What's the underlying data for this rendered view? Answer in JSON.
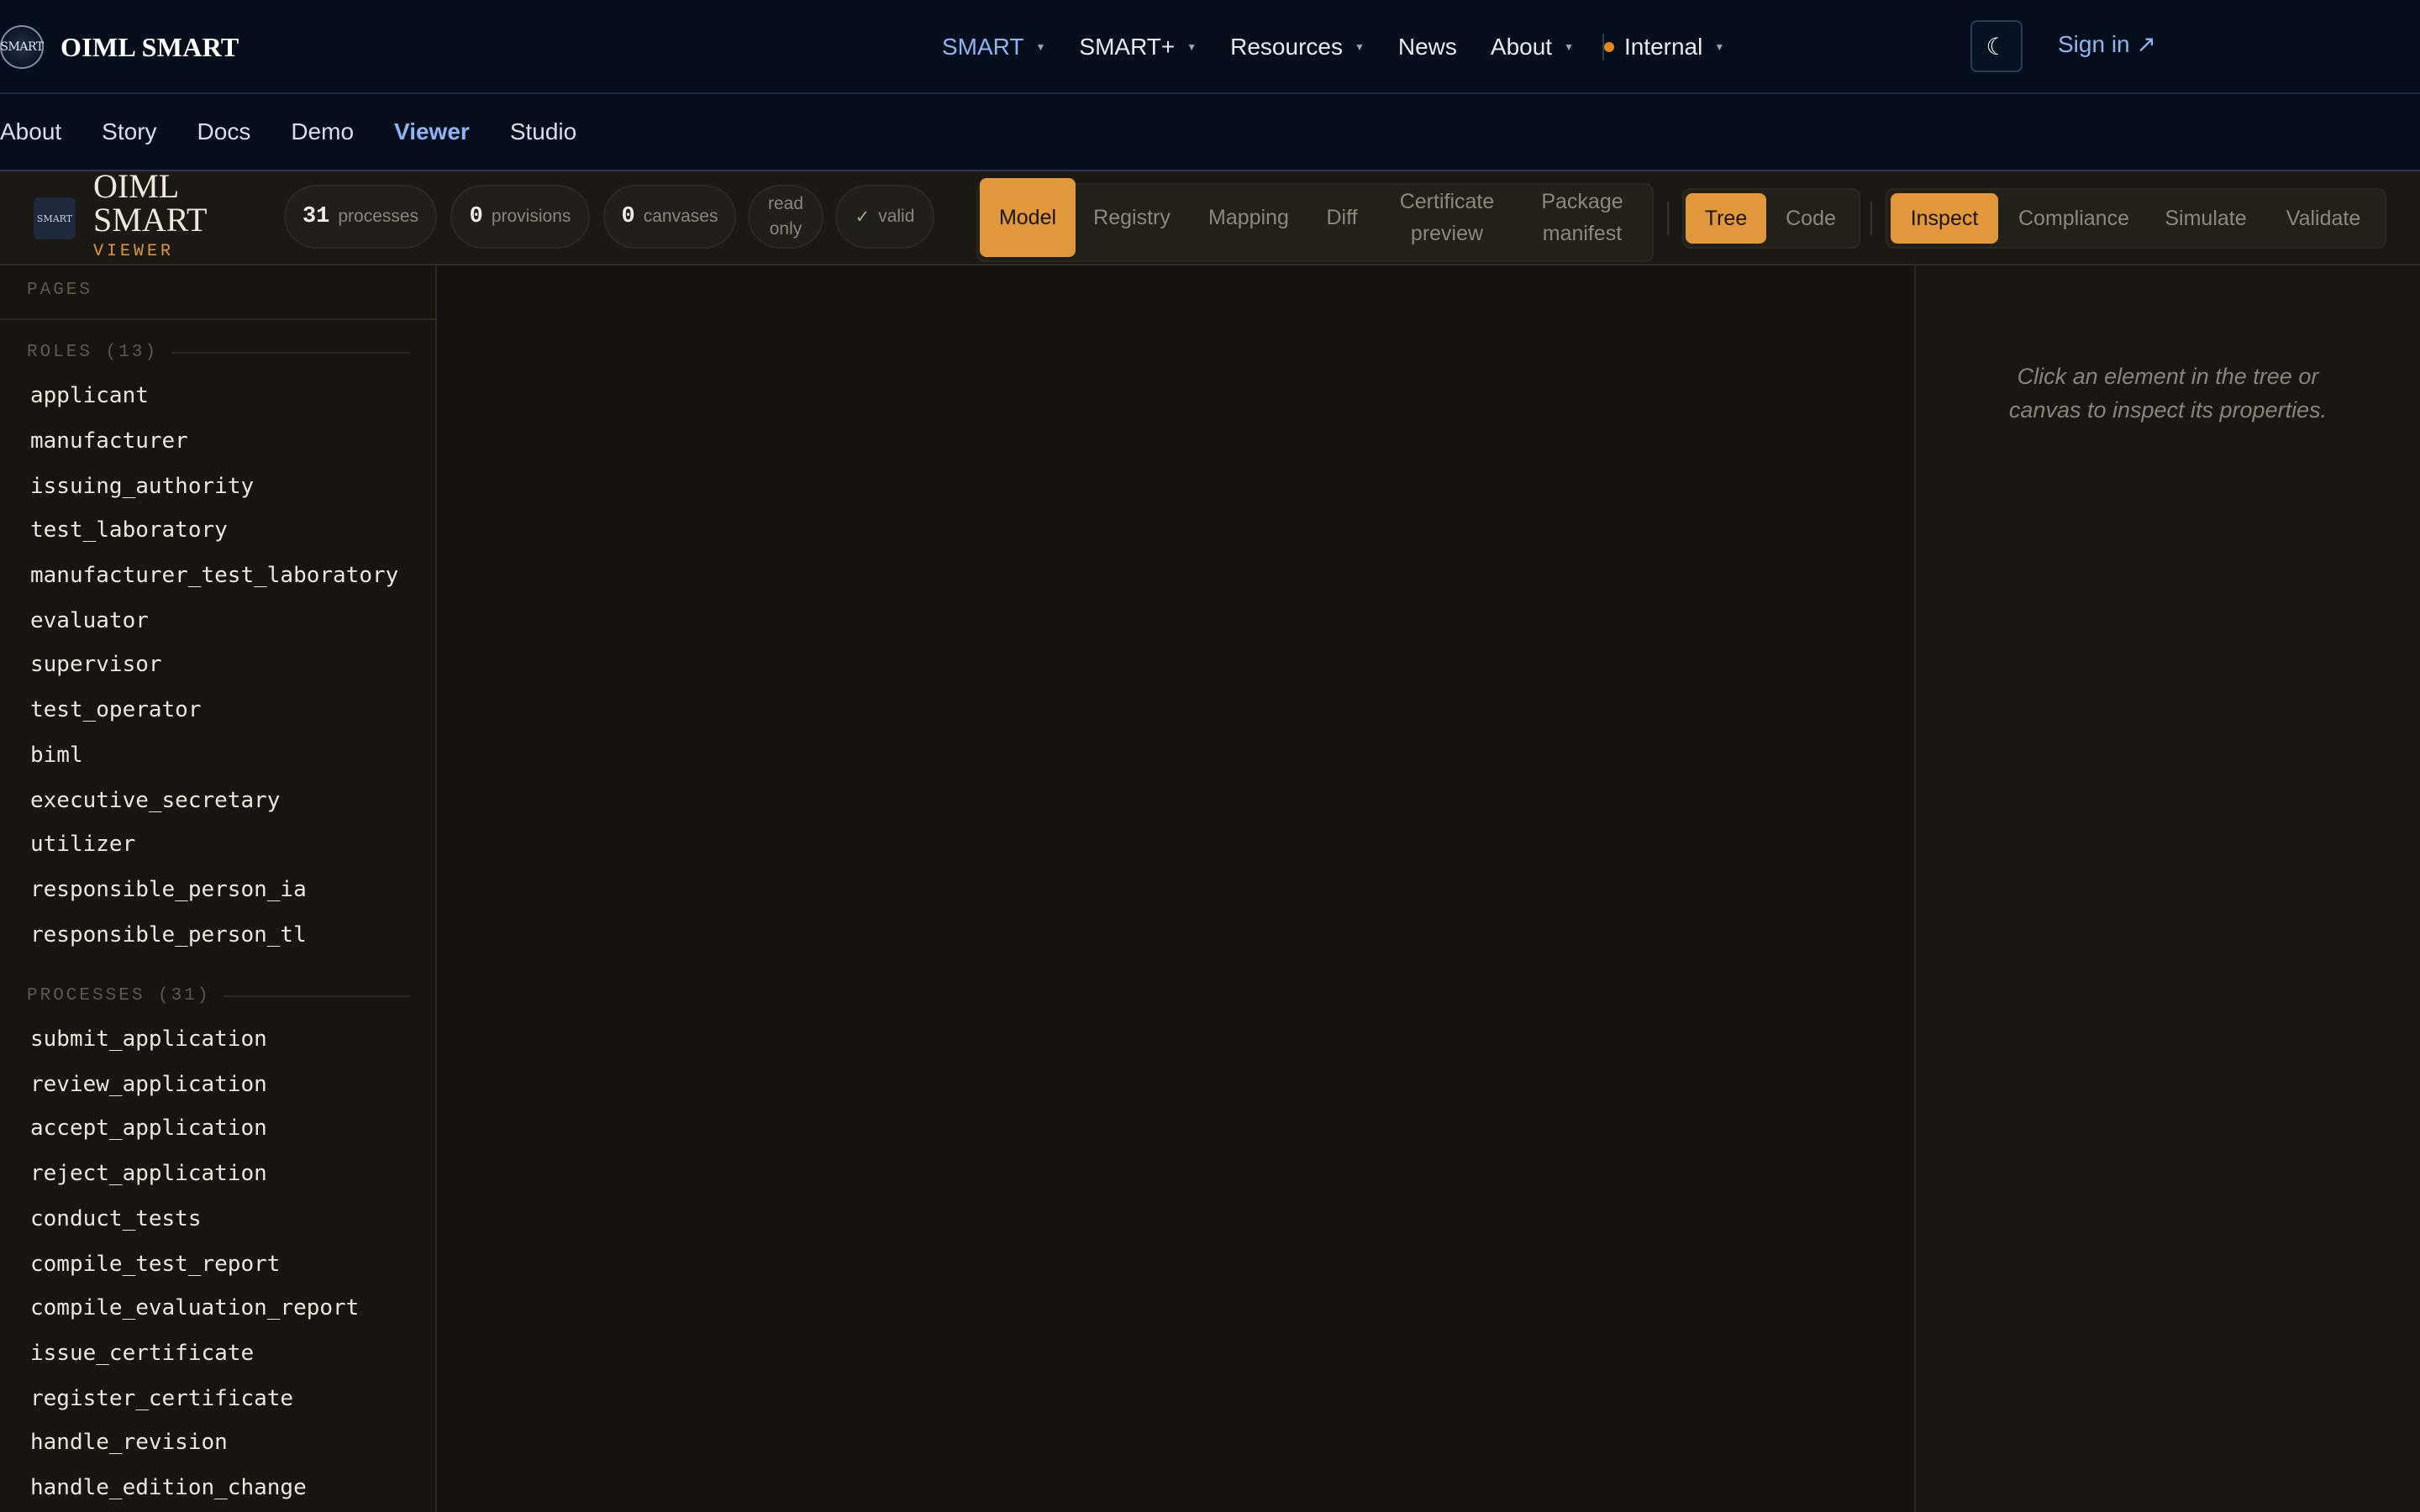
{
  "brand": {
    "logo_text": "SMART",
    "name": "OIML SMART"
  },
  "mainmenu": [
    {
      "label": "SMART",
      "caret": true,
      "active": true
    },
    {
      "label": "SMART+",
      "caret": true
    },
    {
      "label": "Resources",
      "caret": true
    },
    {
      "label": "News",
      "caret": false
    },
    {
      "label": "About",
      "caret": true
    },
    {
      "label": "Internal",
      "caret": true,
      "dot": true
    }
  ],
  "signin": "Sign in ↗",
  "theme_icon": "moon-icon",
  "subnav": [
    "About",
    "Story",
    "Docs",
    "Demo",
    "Viewer",
    "Studio"
  ],
  "subnav_active": "Viewer",
  "viewer": {
    "logo_text": "SMART",
    "title_line1": "OIML",
    "title_line2": "SMART",
    "subtitle": "VIEWER",
    "stats": {
      "processes": {
        "value": "31",
        "label": "processes"
      },
      "provisions": {
        "value": "0",
        "label": "provisions"
      },
      "canvases": {
        "value": "0",
        "label": "canvases"
      },
      "read_only": [
        "read",
        "only"
      ],
      "valid": "valid"
    },
    "view_tabs": [
      {
        "label": "Model",
        "active": true
      },
      {
        "label": "Registry"
      },
      {
        "label": "Mapping"
      },
      {
        "label": "Diff"
      },
      {
        "label": "Certificate preview"
      },
      {
        "label": "Package manifest"
      }
    ],
    "mode_tabs": [
      {
        "label": "Tree",
        "active": true
      },
      {
        "label": "Code"
      }
    ],
    "panel_tabs": [
      {
        "label": "Inspect",
        "active": true
      },
      {
        "label": "Compliance"
      },
      {
        "label": "Simulate"
      },
      {
        "label": "Validate"
      }
    ]
  },
  "sidebar": {
    "pages_header": "PAGES",
    "roles_header": "ROLES (13)",
    "roles": [
      "applicant",
      "manufacturer",
      "issuing_authority",
      "test_laboratory",
      "manufacturer_test_laboratory",
      "evaluator",
      "supervisor",
      "test_operator",
      "biml",
      "executive_secretary",
      "utilizer",
      "responsible_person_ia",
      "responsible_person_tl"
    ],
    "processes_header": "PROCESSES (31)",
    "processes": [
      "submit_application",
      "review_application",
      "accept_application",
      "reject_application",
      "conduct_tests",
      "compile_test_report",
      "compile_evaluation_report",
      "issue_certificate",
      "register_certificate",
      "handle_revision",
      "handle_edition_change"
    ]
  },
  "inspector": {
    "hint": "Click an element in the tree or canvas to inspect its properties."
  },
  "colors": {
    "accent": "#e1983a",
    "link": "#8fb4f5",
    "nav_bg": "#050e1a",
    "app_bg": "#151210",
    "status_dot": "#e08a1e"
  }
}
